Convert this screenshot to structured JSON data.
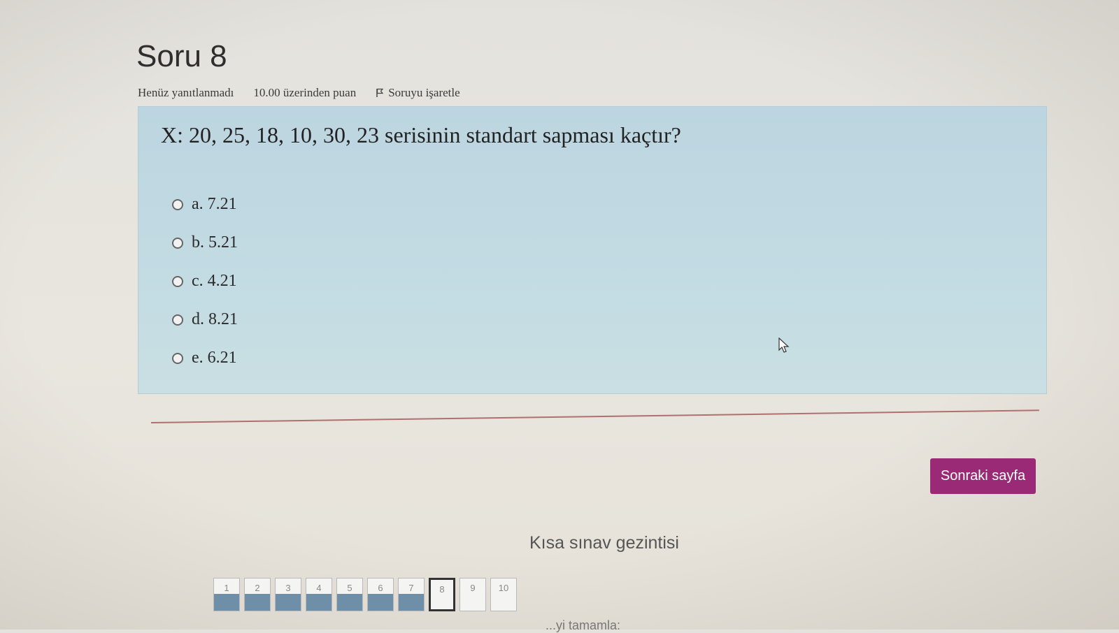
{
  "question": {
    "title": "Soru 8",
    "status": "Henüz yanıtlanmadı",
    "points": "10.00 üzerinden puan",
    "flag_label": "Soruyu işaretle",
    "text": "X: 20, 25, 18, 10, 30, 23 serisinin standart sapması kaçtır?",
    "options": [
      {
        "label": "a. 7.21"
      },
      {
        "label": "b. 5.21"
      },
      {
        "label": "c. 4.21"
      },
      {
        "label": "d. 8.21"
      },
      {
        "label": "e. 6.21"
      }
    ]
  },
  "next_button": "Sonraki sayfa",
  "quiz_nav": {
    "title": "Kısa sınav gezintisi",
    "items": [
      {
        "num": "1",
        "answered": true
      },
      {
        "num": "2",
        "answered": true
      },
      {
        "num": "3",
        "answered": true
      },
      {
        "num": "4",
        "answered": true
      },
      {
        "num": "5",
        "answered": true
      },
      {
        "num": "6",
        "answered": true
      },
      {
        "num": "7",
        "answered": true
      },
      {
        "num": "8",
        "answered": false,
        "current": true
      },
      {
        "num": "9",
        "answered": false
      },
      {
        "num": "10",
        "answered": false
      }
    ]
  },
  "footer_partial": "...yi tamamla:",
  "colors": {
    "question_bg": "#c3dbe3",
    "accent": "#9a2a76",
    "answered": "#6f8fa8"
  }
}
